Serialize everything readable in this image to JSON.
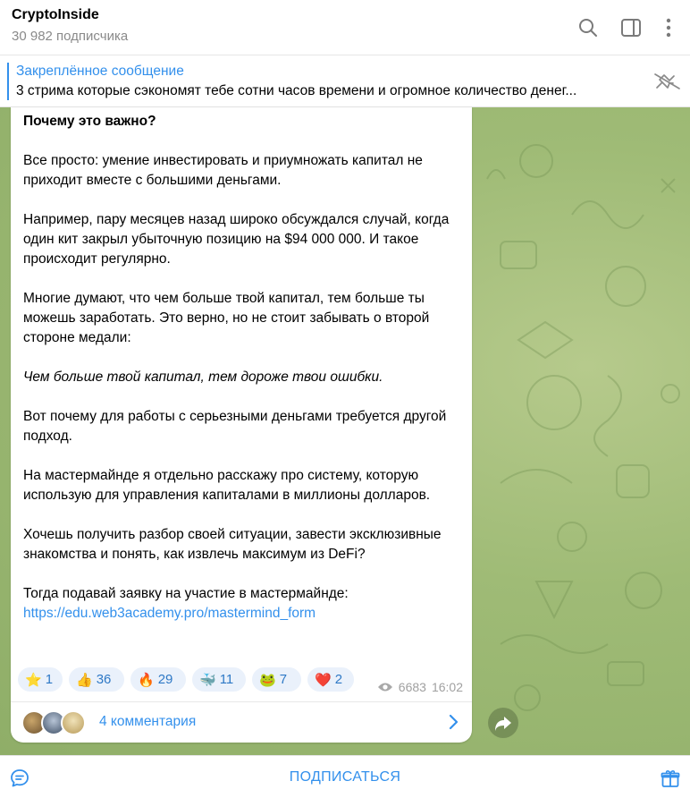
{
  "header": {
    "title": "CryptoInside",
    "subscribers": "30 982 подписчика"
  },
  "pinned": {
    "title": "Закреплённое сообщение",
    "text": "3 стрима которые сэкономят тебе сотни часов времени и огромное количество денег..."
  },
  "message": {
    "heading": "Почему это важно?",
    "p1": "Все просто: умение инвестировать и приумножать капитал не приходит вместе с большими деньгами.",
    "p2": "Например, пару месяцев назад широко обсуждался случай, когда один кит закрыл убыточную позицию на $94 000 000. И такое происходит регулярно.",
    "p3": "Многие думают, что чем больше твой капитал, тем больше ты можешь заработать. Это верно, но не стоит забывать о второй стороне медали:",
    "p4": "Чем больше твой капитал, тем дороже твои ошибки.",
    "p5": "Вот почему для работы с серьезными деньгами требуется другой подход.",
    "p6": "На мастермайнде я отдельно расскажу про систему, которую использую для управления капиталами в миллионы долларов.",
    "p7": "Хочешь получить разбор своей ситуации, завести эксклюзивные знакомства и понять, как извлечь максимум из DeFi?",
    "p8": "Тогда подавай заявку на участие в мастермайнде:",
    "link": "https://edu.web3academy.pro/mastermind_form",
    "reactions": [
      {
        "emoji": "⭐",
        "count": "1"
      },
      {
        "emoji": "👍",
        "count": "36"
      },
      {
        "emoji": "🔥",
        "count": "29"
      },
      {
        "emoji": "🐳",
        "count": "11"
      },
      {
        "emoji": "🐸",
        "count": "7"
      },
      {
        "emoji": "❤️",
        "count": "2"
      }
    ],
    "views": "6683",
    "time": "16:02",
    "comments": "4 комментария"
  },
  "footer": {
    "subscribe": "ПОДПИСАТЬСЯ"
  },
  "colors": {
    "accent": "#3390ec",
    "chat_background": "#9fbb76"
  }
}
